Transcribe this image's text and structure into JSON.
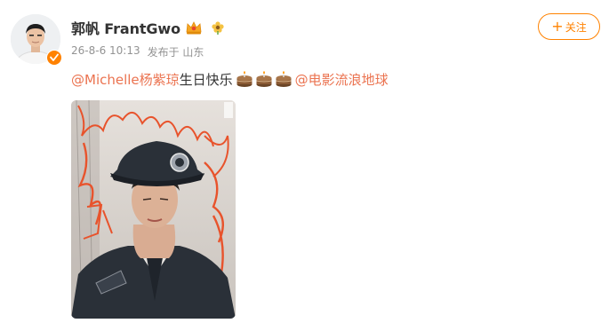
{
  "user": {
    "name": "郭帆 FrantGwo",
    "crown_icon": "crown-icon",
    "flower_icon": "flower-icon",
    "verified_icon": "verified-badge-icon"
  },
  "meta": {
    "timestamp": "26-8-6 10:13",
    "location": "发布于 山东"
  },
  "follow_button": {
    "plus": "+",
    "label": "关注"
  },
  "post": {
    "mention_1": "@Michelle杨紫琼",
    "text": " 生日快乐",
    "mention_2": "@电影流浪地球"
  },
  "colors": {
    "accent": "#ff8200",
    "mention": "#eb7350",
    "meta": "#939393"
  }
}
